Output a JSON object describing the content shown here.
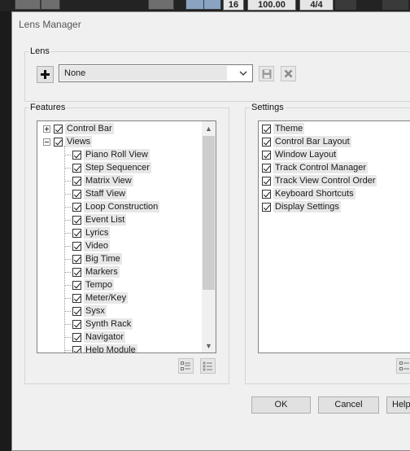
{
  "top_strip": {
    "time_sig_top": "16",
    "tempo": "100.00",
    "meter": "4/4"
  },
  "dialog": {
    "title": "Lens Manager"
  },
  "lens": {
    "group_label": "Lens",
    "combo_value": "None",
    "add_icon": "plus-icon",
    "save_icon": "save-icon",
    "delete_icon": "delete-icon"
  },
  "features": {
    "group_label": "Features",
    "items": [
      {
        "label": "Control Bar",
        "level": 0,
        "expander": "plus",
        "checked": true
      },
      {
        "label": "Views",
        "level": 0,
        "expander": "minus",
        "checked": true
      },
      {
        "label": "Piano Roll View",
        "level": 1,
        "checked": true
      },
      {
        "label": "Step Sequencer",
        "level": 1,
        "checked": true
      },
      {
        "label": "Matrix View",
        "level": 1,
        "checked": true
      },
      {
        "label": "Staff View",
        "level": 1,
        "checked": true
      },
      {
        "label": "Loop Construction",
        "level": 1,
        "checked": true
      },
      {
        "label": "Event List",
        "level": 1,
        "checked": true
      },
      {
        "label": "Lyrics",
        "level": 1,
        "checked": true
      },
      {
        "label": "Video",
        "level": 1,
        "checked": true
      },
      {
        "label": "Big Time",
        "level": 1,
        "checked": true
      },
      {
        "label": "Markers",
        "level": 1,
        "checked": true
      },
      {
        "label": "Tempo",
        "level": 1,
        "checked": true
      },
      {
        "label": "Meter/Key",
        "level": 1,
        "checked": true
      },
      {
        "label": "Sysx",
        "level": 1,
        "checked": true
      },
      {
        "label": "Synth Rack",
        "level": 1,
        "checked": true
      },
      {
        "label": "Navigator",
        "level": 1,
        "checked": true
      },
      {
        "label": "Help Module",
        "level": 1,
        "checked": true
      }
    ],
    "check_all_icon": "check-all-icon",
    "uncheck_all_icon": "uncheck-all-icon"
  },
  "settings": {
    "group_label": "Settings",
    "items": [
      {
        "label": "Theme",
        "checked": true
      },
      {
        "label": "Control Bar Layout",
        "checked": true
      },
      {
        "label": "Window Layout",
        "checked": true
      },
      {
        "label": "Track Control Manager",
        "checked": true
      },
      {
        "label": "Track View Control Order",
        "checked": true
      },
      {
        "label": "Keyboard Shortcuts",
        "checked": true
      },
      {
        "label": "Display Settings",
        "checked": true
      }
    ]
  },
  "buttons": {
    "ok": "OK",
    "cancel": "Cancel",
    "help": "Help"
  },
  "colors": {
    "dialog_bg": "#f0f0f0",
    "daw_bg": "#1b1b1b",
    "item_highlight": "#e7e7e7"
  }
}
